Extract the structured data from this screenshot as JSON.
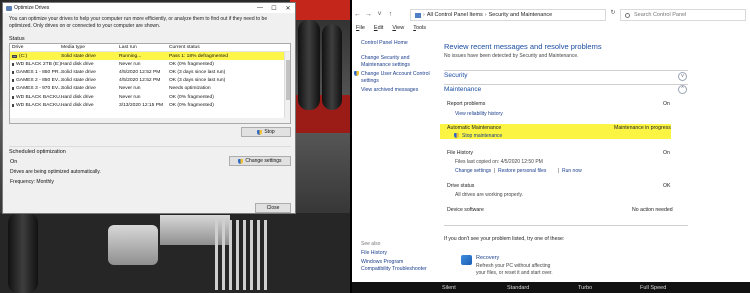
{
  "optimize_drives": {
    "title": "Optimize Drives",
    "window_controls": [
      "—",
      "☐",
      "✕"
    ],
    "description": "You can optimize your drives to help your computer run more efficiently, or analyze them to find out if they need to be optimized. Only drives on or connected to your computer are shown.",
    "status_label": "Status",
    "columns": [
      "Drive",
      "Media type",
      "Last run",
      "Current status"
    ],
    "rows": [
      {
        "drive": "(C:)",
        "media": "Solid state drive",
        "last_run": "Running...",
        "status": "Pass 1: 18% defragmented",
        "selected": true
      },
      {
        "drive": "WD BLACK 2TB (E:)",
        "media": "Hard disk drive",
        "last_run": "Never run",
        "status": "OK (0% fragmented)"
      },
      {
        "drive": "GAMES 1 - 850 PR...",
        "media": "Solid state drive",
        "last_run": "4/5/2020 12:52 PM",
        "status": "OK (3 days since last run)"
      },
      {
        "drive": "GAMES 2 - 850 EV...",
        "media": "Solid state drive",
        "last_run": "4/5/2020 12:52 PM",
        "status": "OK (3 days since last run)"
      },
      {
        "drive": "GAMES 3 - 970 EV...",
        "media": "Solid state drive",
        "last_run": "Never run",
        "status": "Needs optimization"
      },
      {
        "drive": "WD BLACK BACKU...",
        "media": "Hard disk drive",
        "last_run": "Never run",
        "status": "OK (0% fragmented)"
      },
      {
        "drive": "WD BLACK BACKU...",
        "media": "Hard disk drive",
        "last_run": "3/13/2020 12:15 PM",
        "status": "OK (0% fragmented)"
      }
    ],
    "stop_label": "Stop",
    "scheduled_label": "Scheduled optimization",
    "sched_on": "On",
    "sched_auto": "Drives are being optimized automatically.",
    "sched_freq": "Frequency: Monthly",
    "change_settings_label": "Change settings",
    "close_label": "Close"
  },
  "control_panel": {
    "nav": {
      "back": "←",
      "forward": "→",
      "down": "˅",
      "up": "↑",
      "refresh": "↻"
    },
    "breadcrumbs": [
      "All Control Panel Items",
      "Security and Maintenance"
    ],
    "search_placeholder": "Search Control Panel",
    "menu": [
      "File",
      "Edit",
      "View",
      "Tools"
    ],
    "left_links": {
      "home": "Control Panel Home",
      "change_settings_1": "Change Security and",
      "change_settings_2": "Maintenance settings",
      "uac_1": "Change User Account Control",
      "uac_2": "settings",
      "archived": "View archived messages",
      "see_also": "See also",
      "file_history": "File History",
      "wpc_1": "Windows Program",
      "wpc_2": "Compatibility Troubleshooter"
    },
    "main": {
      "title": "Review recent messages and resolve problems",
      "subtitle": "No issues have been detected by Security and Maintenance.",
      "security": "Security",
      "maintenance": "Maintenance",
      "report_problems": "Report problems",
      "report_problems_val": "On",
      "view_reliability": "View reliability history",
      "auto_maintenance": "Automatic Maintenance",
      "auto_maintenance_val": "Maintenance in progress",
      "stop_maintenance": "Stop maintenance",
      "file_history": "File History",
      "file_history_val": "On",
      "files_copied": "Files last copied on: 4/5/2020 12:50 PM",
      "change_settings": "Change settings",
      "restore_files": "Restore personal files",
      "run_now": "Run now",
      "drive_status": "Drive status",
      "drive_status_val": "OK",
      "drives_working": "All drives are working properly.",
      "device_software": "Device software",
      "device_software_val": "No action needed",
      "not_listed": "If you don't see your problem listed, try one of these:",
      "recovery": "Recovery",
      "recovery_desc_1": "Refresh your PC without affecting",
      "recovery_desc_2": "your files, or reset it and start over."
    }
  },
  "bottom_strip": [
    "Silent",
    "Standard",
    "Turbo",
    "Full Speed"
  ],
  "colors": {
    "highlight": "#fdf54a",
    "link": "#1a3e8c",
    "heading": "#1b4da3"
  }
}
